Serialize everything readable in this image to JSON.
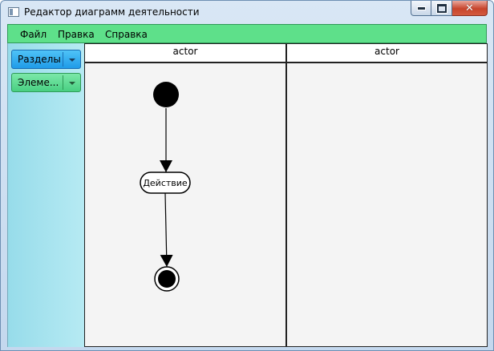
{
  "window": {
    "title": "Редактор диаграмм деятельности",
    "buttons": {
      "minimize_icon": "minimize-icon",
      "maximize_icon": "maximize-icon",
      "close_icon": "close-icon"
    }
  },
  "menu": {
    "items": [
      "Файл",
      "Правка",
      "Справка"
    ]
  },
  "sidebar": {
    "sections_combo": "Разделы",
    "elements_combo": "Элеме..."
  },
  "diagram": {
    "lanes": [
      "actor",
      "actor"
    ],
    "nodes": {
      "initial": "initial-node",
      "action": "Действие",
      "final": "final-node"
    }
  },
  "colors": {
    "menubar": "#5ee08a",
    "sidebar": "#a8e5f0",
    "combo_blue": "#1f9be8",
    "combo_green": "#49cf82",
    "canvas": "#f4f4f4"
  }
}
